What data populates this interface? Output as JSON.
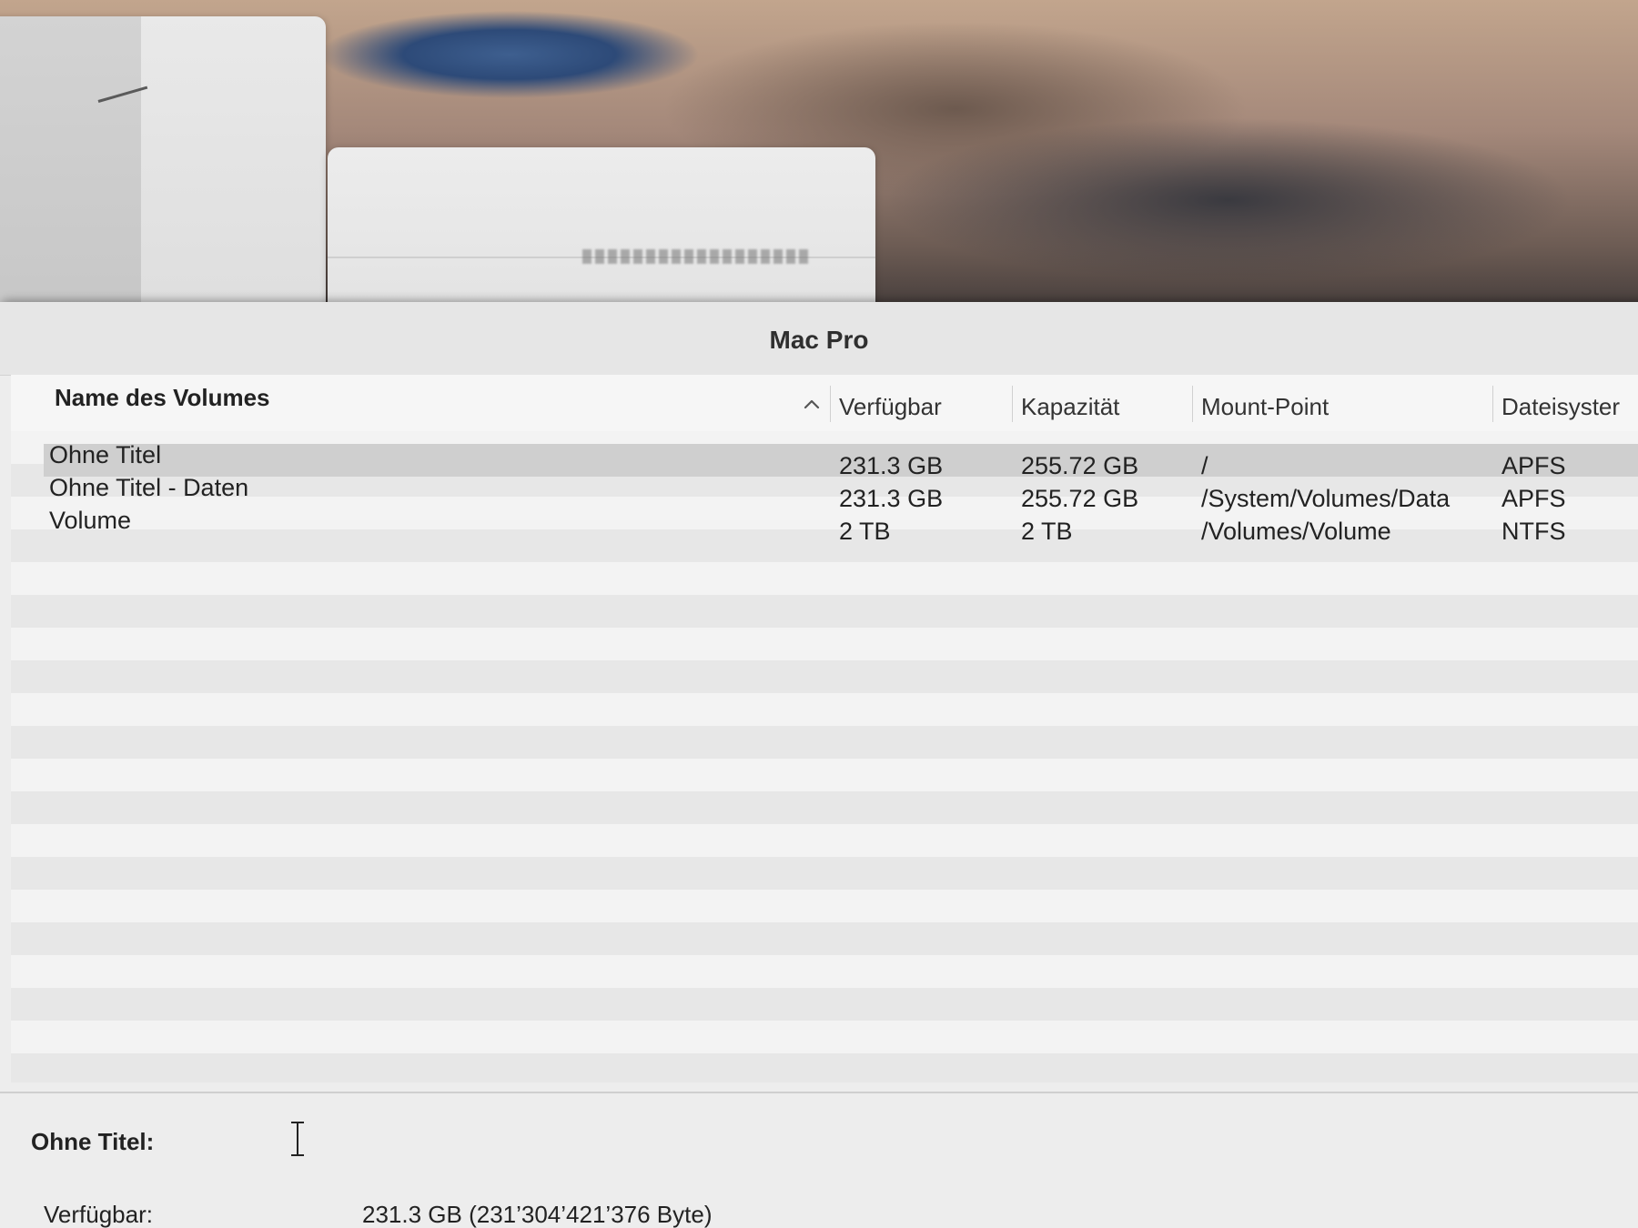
{
  "window": {
    "title": "Mac Pro"
  },
  "table": {
    "columns": [
      {
        "label": "Name des Volumes",
        "sorted": "ascending"
      },
      {
        "label": "Verfügbar"
      },
      {
        "label": "Kapazität"
      },
      {
        "label": "Mount-Point"
      },
      {
        "label": "Dateisyster"
      }
    ],
    "sort_icon": "chevron-up-icon",
    "rows": [
      {
        "name": "Ohne Titel",
        "available": "231.3 GB",
        "capacity": "255.72 GB",
        "mount": "/",
        "fs": "APFS",
        "selected": true
      },
      {
        "name": "Ohne Titel - Daten",
        "available": "231.3 GB",
        "capacity": "255.72 GB",
        "mount": "/System/Volumes/Data",
        "fs": "APFS",
        "selected": false
      },
      {
        "name": "Volume",
        "available": "2 TB",
        "capacity": "2 TB",
        "mount": "/Volumes/Volume",
        "fs": "NTFS",
        "selected": false
      }
    ]
  },
  "details": {
    "title": "Ohne Titel:",
    "cursor_icon": "text-cursor-icon",
    "items": [
      {
        "label": "Verfügbar:",
        "value": "231.3 GB (231’304’421’376 Byte)"
      }
    ]
  }
}
